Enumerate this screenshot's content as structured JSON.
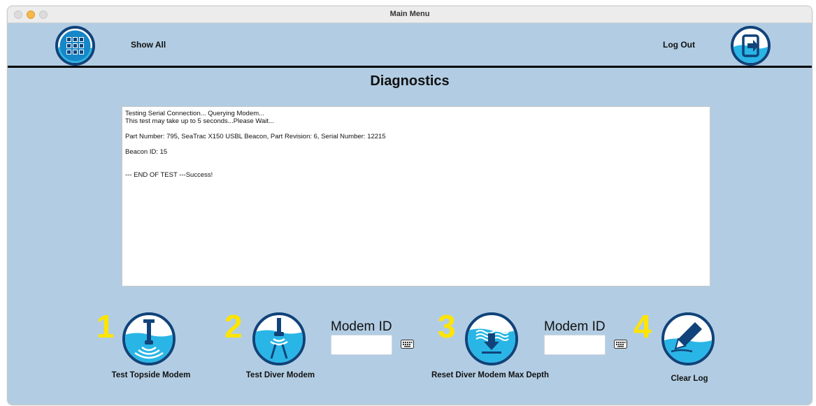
{
  "window": {
    "title": "Main Menu"
  },
  "header": {
    "show_all_label": "Show All",
    "logout_label": "Log Out",
    "show_all_icon": "grid-icon",
    "logout_icon": "exit-door-icon"
  },
  "page": {
    "title": "Diagnostics"
  },
  "log": {
    "lines": [
      "Testing Serial Connection... Querying Modem...",
      "This test may take up to 5 seconds...Please Wait...",
      "",
      "Part Number: 795, SeaTrac X150 USBL Beacon, Part Revision: 6, Serial Number: 12215",
      "",
      "Beacon ID: 15",
      "",
      "",
      "--- END OF TEST ---Success!"
    ]
  },
  "actions": [
    {
      "number": "1",
      "label": "Test Topside Modem",
      "icon": "topside-modem-icon"
    },
    {
      "number": "2",
      "label": "Test Diver Modem",
      "icon": "diver-modem-icon"
    },
    {
      "number": "3",
      "label": "Reset Diver Modem Max Depth",
      "icon": "reset-depth-icon"
    },
    {
      "number": "4",
      "label": "Clear Log",
      "icon": "clear-log-pen-icon"
    }
  ],
  "modem_fields": [
    {
      "label": "Modem ID",
      "value": "",
      "placeholder": "",
      "icon": "keyboard-icon"
    },
    {
      "label": "Modem ID",
      "value": "",
      "placeholder": "",
      "icon": "keyboard-icon"
    }
  ],
  "colors": {
    "background": "#b2cde3",
    "button_ring": "#11437a",
    "water": "#29b6e6",
    "step_number": "#ffe500"
  }
}
